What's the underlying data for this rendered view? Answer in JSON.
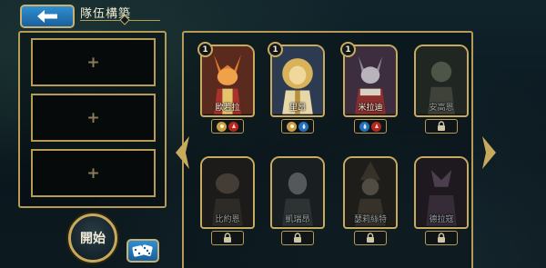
{
  "header": {
    "title": "隊伍構築",
    "back_icon": "back-arrow-icon"
  },
  "team_slots": [
    {
      "symbol": "+"
    },
    {
      "symbol": "+"
    },
    {
      "symbol": "+"
    }
  ],
  "actions": {
    "start_label": "開始",
    "random_icon": "dice-icon"
  },
  "colors": {
    "accent_gold": "#b79a55",
    "button_blue": "#2f8fd0",
    "trait_red": "#b0281e",
    "trait_blue": "#2370b8",
    "trait_gold": "#caa14a"
  },
  "heroes": [
    {
      "name": "歐若拉",
      "level": "1",
      "unlocked": true,
      "traits": [
        "gold",
        "red"
      ]
    },
    {
      "name": "里昂",
      "level": "1",
      "unlocked": true,
      "traits": [
        "gold",
        "blue"
      ]
    },
    {
      "name": "米拉迪",
      "level": "1",
      "unlocked": true,
      "traits": [
        "blue",
        "red"
      ]
    },
    {
      "name": "安高恩",
      "unlocked": false
    },
    {
      "name": "比約恩",
      "unlocked": false
    },
    {
      "name": "凱瑞昂",
      "unlocked": false
    },
    {
      "name": "瑟莉絲特",
      "unlocked": false
    },
    {
      "name": "德拉寇",
      "unlocked": false
    }
  ],
  "nav": {
    "prev_icon": "chevron-left-icon",
    "next_icon": "chevron-right-icon"
  }
}
